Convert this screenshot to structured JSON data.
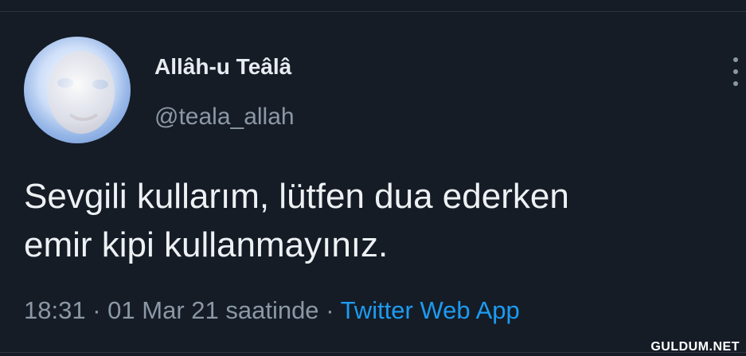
{
  "tweet": {
    "display_name": "Allâh-u Teâlâ",
    "handle": "@teala_allah",
    "text_line1": "Sevgili kullarım, lütfen dua ederken",
    "text_line2": "emir kipi kullanmayınız.",
    "time": "18:31",
    "date": "01 Mar 21 saatinde",
    "separator": "·",
    "source": "Twitter Web App",
    "more_icon": "more-vertical-icon"
  },
  "watermark": "GULDUM.NET",
  "colors": {
    "background": "#151c26",
    "text_primary": "#eef1f4",
    "text_secondary": "#8b98a5",
    "link": "#1d9bf0"
  }
}
